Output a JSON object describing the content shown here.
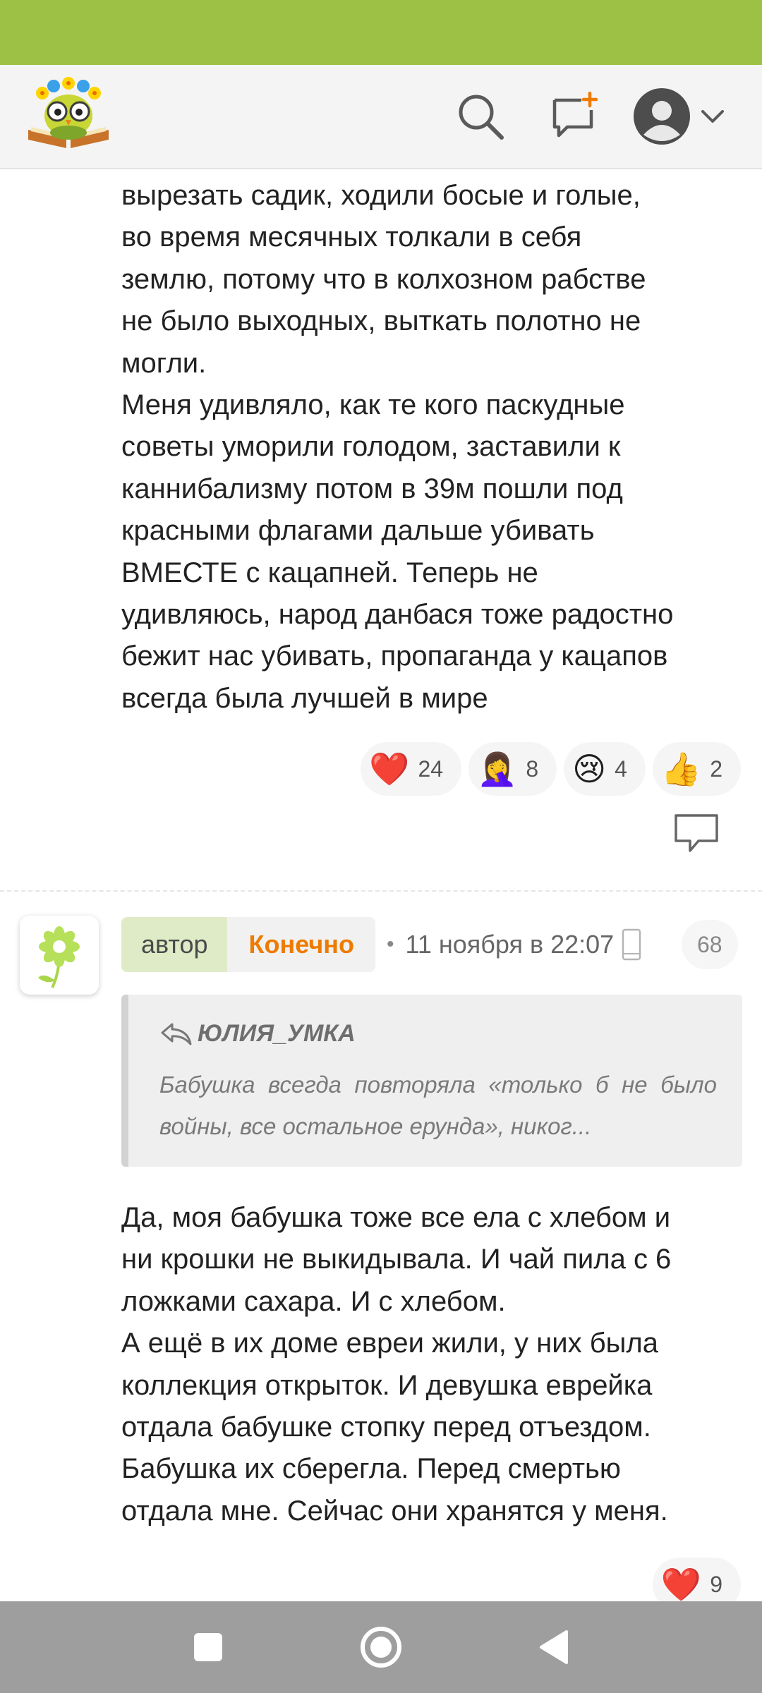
{
  "header": {
    "logo_icon": "owl-on-book-logo",
    "search_icon": "search-icon",
    "compose_icon": "new-message-icon",
    "profile_icon": "user-avatar-icon"
  },
  "post1": {
    "text": "вырезать садик, ходили босые и голые,\nво время месячных толкали в себя\nземлю, потому что в колхозном рабстве\nне было выходных, выткать полотно не\nмогли.\nМеня удивляло, как те кого паскудные\nсоветы уморили голодом, заставили к\nканнибализму потом в 39м пошли под\nкрасными флагами дальше убивать\nВМЕСТЕ с кацапней. Теперь не\nудивляюсь, народ данбася тоже радостно\nбежит нас убивать, пропаганда у кацапов\nвсегда была лучшей в мире",
    "reactions": [
      {
        "emoji": "❤️",
        "count": "24"
      },
      {
        "emoji": "🤦‍♀️",
        "count": "8"
      },
      {
        "emoji": "😢",
        "count": "4"
      },
      {
        "emoji": "👍",
        "count": "2"
      }
    ]
  },
  "comment": {
    "author_badge": "автор",
    "author_name": "Конечно",
    "separator": "•",
    "timestamp": "11 ноября в 22:07",
    "reply_count": "68",
    "quote": {
      "author": "ЮЛИЯ_УМКА",
      "text": "Бабушка всегда повторяла «только б не было войны, все остальное ерунда», никог..."
    },
    "text": "Да, моя бабушка тоже все ела с хлебом и\nни крошки не выкидывала. И чай пила с 6\nложками сахара. И с хлебом.\nА ещё в их доме евреи жили, у них была\nколлекция открыток. И девушка еврейка\nотдала бабушке стопку перед отъездом.\nБабушка их сберегла. Перед смертью\nотдала мне. Сейчас они хранятся у меня.",
    "reactions": [
      {
        "emoji": "❤️",
        "count": "9"
      }
    ]
  },
  "colors": {
    "status_bar": "#9dc145",
    "author_name": "#ee7b00",
    "author_badge_bg": "#dfebc6",
    "nav_bar": "#9e9e9e"
  }
}
